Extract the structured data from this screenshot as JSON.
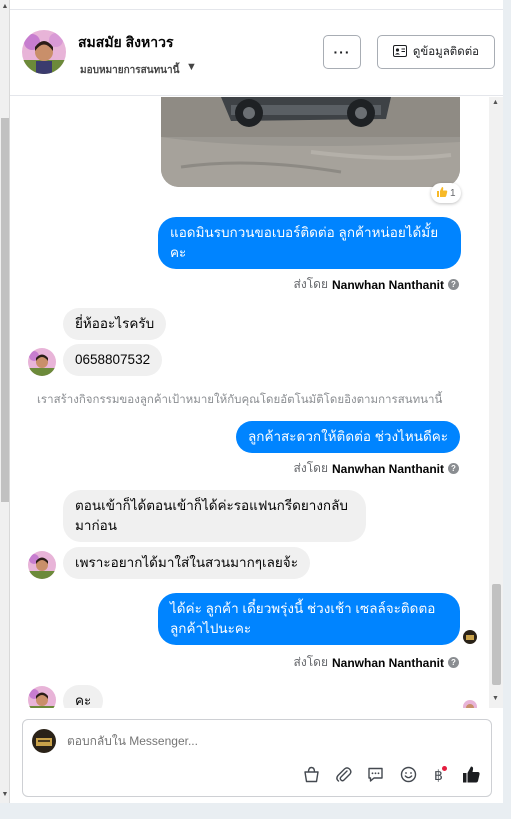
{
  "header": {
    "contact_name": "สมสมัย สิงหาวร",
    "assign_label": "มอบหมายการสนทนานี้",
    "more_label": "···",
    "contact_info_label": "ดูข้อมูลติดต่อ"
  },
  "thread": {
    "reaction_count": "1",
    "reaction_icon": "thumbs-up-icon",
    "messages": [
      {
        "direction": "outgoing",
        "text": "แอดมินรบกวนขอเบอร์ติดต่อ ลูกค้าหน่อยได้มั้ยคะ"
      },
      {
        "direction": "incoming",
        "text": "ยี่ห้ออะไรครับ"
      },
      {
        "direction": "incoming",
        "text": "0658807532"
      },
      {
        "direction": "outgoing",
        "text": "ลูกค้าสะดวกให้ติดต่อ ช่วงไหนดีคะ"
      },
      {
        "direction": "incoming",
        "text": "ตอนเข้าก็ได้ตอนเข้าก็ได้ค่ะรอแฟนกรีดยางกลับมาก่อน"
      },
      {
        "direction": "incoming",
        "text": "เพราะอยากได้มาใส่ในสวนมากๆเลยจ้ะ"
      },
      {
        "direction": "outgoing",
        "text": "ได้ค่ะ ลูกค้า เดี๋ยวพรุ่งนี้ ช่วงเช้า เซลล์จะติดตอลูกค้าไปนะคะ"
      },
      {
        "direction": "incoming",
        "text": "คะ"
      }
    ],
    "sent_by_prefix": "ส่งโดย",
    "sent_by_name": "Nanwhan Nanthanit",
    "system_note": "เราสร้างกิจกรรมของลูกค้าเป้าหมายให้กับคุณโดยอัตโนมัติโดยอิงตามการสนทนานี้"
  },
  "composer": {
    "placeholder": "ตอบกลับใน Messenger...",
    "tools": [
      "shopping-bag-icon",
      "paperclip-icon",
      "speech-bubble-icon",
      "smiley-icon",
      "baht-icon",
      "thumbs-up-icon"
    ]
  },
  "colors": {
    "outgoing_bubble": "#0084ff",
    "incoming_bubble": "#f0f0f0",
    "badge_red": "#e41e3f"
  }
}
